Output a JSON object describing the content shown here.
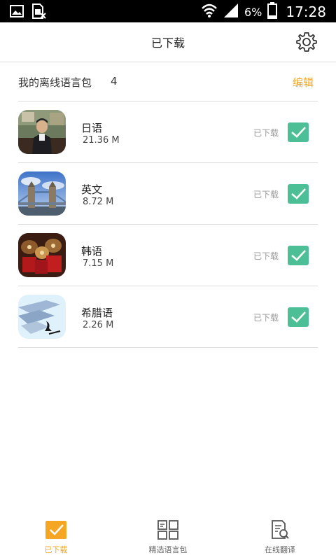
{
  "status_bar": {
    "battery": "6%",
    "time": "17:28"
  },
  "header": {
    "title": "已下载"
  },
  "summary": {
    "label": "我的离线语言包",
    "count": "4",
    "edit": "编辑"
  },
  "items": [
    {
      "name": "日语",
      "size": "21.36 M",
      "status": "已下载"
    },
    {
      "name": "英文",
      "size": "8.72 M",
      "status": "已下载"
    },
    {
      "name": "韩语",
      "size": "7.15 M",
      "status": "已下载"
    },
    {
      "name": "希腊语",
      "size": "2.26 M",
      "status": "已下载"
    }
  ],
  "bottom_nav": [
    {
      "label": "已下载",
      "icon": "download-check-icon",
      "active": true
    },
    {
      "label": "精选语言包",
      "icon": "grid-icon",
      "active": false
    },
    {
      "label": "在线翻译",
      "icon": "translate-doc-icon",
      "active": false
    }
  ],
  "colors": {
    "accent": "#f5a623",
    "check": "#4dbf96"
  }
}
